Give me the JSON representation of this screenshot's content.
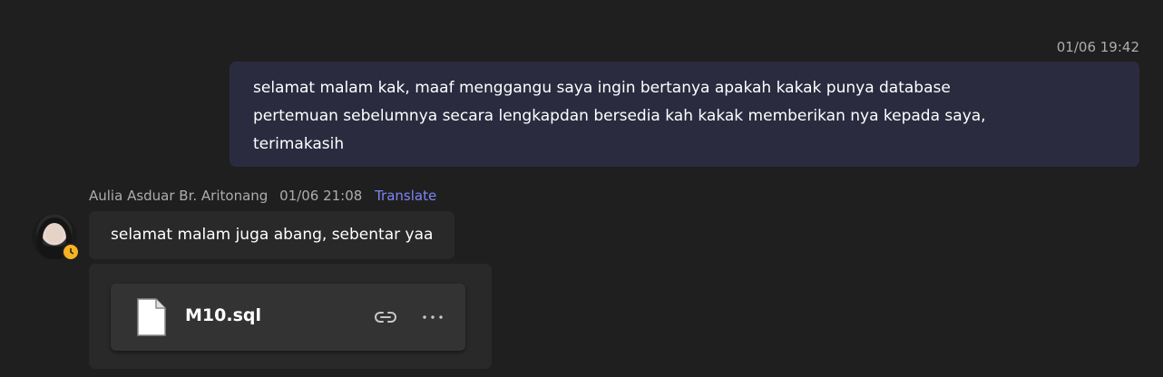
{
  "outgoing_message": {
    "timestamp": "01/06 19:42",
    "text_lines": [
      "selamat malam kak, maaf menggangu saya ingin bertanya apakah kakak punya database",
      "pertemuan sebelumnya secara lengkapdan bersedia kah kakak memberikan nya kepada saya,",
      "terimakasih"
    ]
  },
  "incoming_message": {
    "sender_name": "Aulia Asduar Br. Aritonang",
    "timestamp": "01/06 21:08",
    "translate_label": "Translate",
    "text": "selamat malam juga abang, sebentar yaa",
    "presence_status": "away"
  },
  "attachment": {
    "file_name": "M10.sql",
    "icon": "file-icon"
  },
  "colors": {
    "background": "#1f1f1f",
    "outgoing_bubble": "#2b2b40",
    "incoming_bubble": "#292929",
    "file_card": "#333333",
    "link": "#7f85f5",
    "meta_text": "#adadad",
    "away_status": "#f8b322"
  }
}
